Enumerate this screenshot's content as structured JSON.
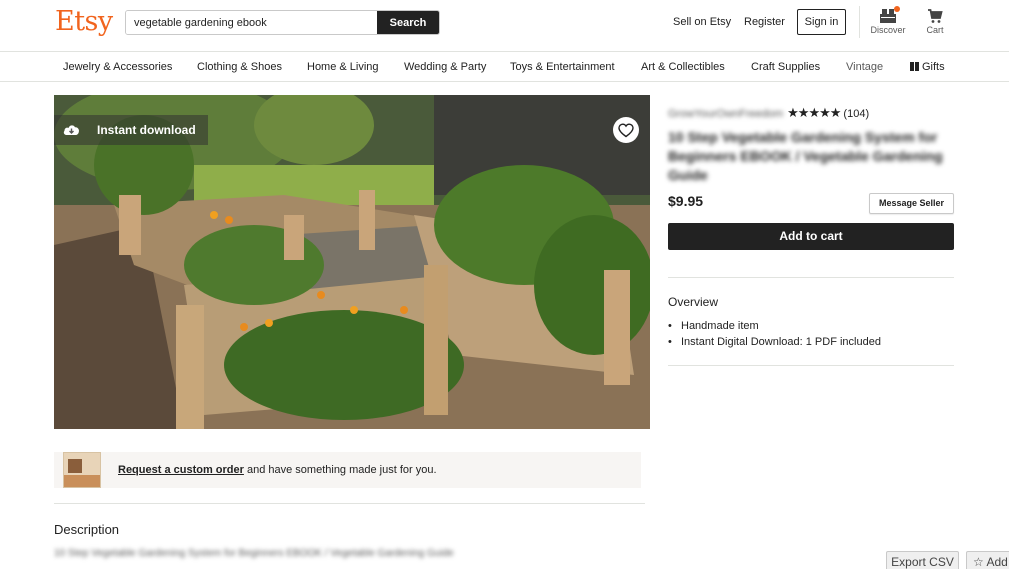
{
  "header": {
    "logo": "Etsy",
    "search": {
      "value": "vegetable gardening ebook",
      "button": "Search"
    },
    "sell_link": "Sell on Etsy",
    "register_link": "Register",
    "signin_button": "Sign in",
    "discover_label": "Discover",
    "cart_label": "Cart",
    "accent_color": "#f1641e"
  },
  "categories": [
    "Jewelry & Accessories",
    "Clothing & Shoes",
    "Home & Living",
    "Wedding & Party",
    "Toys & Entertainment",
    "Art & Collectibles",
    "Craft Supplies",
    "Vintage",
    "Gifts"
  ],
  "listing": {
    "badge": "Instant download",
    "shop_name": "GrowYourOwnFreedom",
    "stars": "★★★★★",
    "review_count": "(104)",
    "title": "10 Step Vegetable Gardening System for Beginners EBOOK / Vegetable Gardening Guide",
    "price": "$9.95",
    "message_seller": "Message Seller",
    "add_to_cart": "Add to cart",
    "overview": {
      "heading": "Overview",
      "items": [
        "Handmade item",
        "Instant Digital Download: 1 PDF included"
      ]
    },
    "custom_order": {
      "link": "Request a custom order",
      "text": " and have something made just for you."
    },
    "description": {
      "heading": "Description",
      "text": "10 Step Vegetable Gardening System for Beginners EBOOK / Vegetable Gardening Guide"
    }
  },
  "floating": {
    "export_csv": "Export CSV",
    "add": "Add"
  }
}
